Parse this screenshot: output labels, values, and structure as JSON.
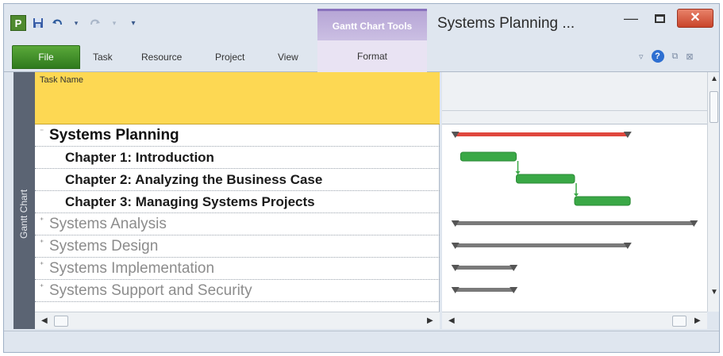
{
  "titlebar": {
    "app_icon_letter": "P",
    "undo_icon": "undo-icon",
    "redo_icon": "redo-icon",
    "contextual_tab_group": "Gantt Chart Tools",
    "document_title": "Systems Planning ...",
    "minimize_glyph": "—",
    "close_glyph": "✕"
  },
  "ribbon": {
    "file_tab": "File",
    "tabs": [
      "Task",
      "Resource",
      "Project",
      "View"
    ],
    "format_tab": "Format",
    "help_glyph": "?"
  },
  "side_label": "Gantt Chart",
  "grid": {
    "column_header": "Task Name",
    "rows": [
      {
        "name": "Systems Planning",
        "level": 1,
        "expanded": true
      },
      {
        "name": "Chapter 1: Introduction",
        "level": 2
      },
      {
        "name": "Chapter 2: Analyzing the Business Case",
        "level": 2
      },
      {
        "name": "Chapter 3: Managing Systems Projects",
        "level": 2
      },
      {
        "name": "Systems Analysis",
        "level": 1,
        "expanded": false
      },
      {
        "name": "Systems Design",
        "level": 1,
        "expanded": false
      },
      {
        "name": "Systems Implementation",
        "level": 1,
        "expanded": false
      },
      {
        "name": "Systems Support and Security",
        "level": 1,
        "expanded": false
      }
    ]
  },
  "gantt": {
    "colors": {
      "critical_summary": "#e0473d",
      "task_bar": "#3aa846",
      "summary": "#7a7a7a",
      "link": "#3aa846"
    },
    "bars": [
      {
        "type": "summary",
        "color": "critical",
        "start": 0.05,
        "end": 0.7
      },
      {
        "type": "task",
        "start": 0.07,
        "end": 0.28
      },
      {
        "type": "task",
        "start": 0.28,
        "end": 0.5
      },
      {
        "type": "task",
        "start": 0.5,
        "end": 0.71
      },
      {
        "type": "summary",
        "color": "summary",
        "start": 0.05,
        "end": 0.95
      },
      {
        "type": "summary",
        "color": "summary",
        "start": 0.05,
        "end": 0.7
      },
      {
        "type": "summary",
        "color": "summary",
        "start": 0.05,
        "end": 0.27
      },
      {
        "type": "summary",
        "color": "summary",
        "start": 0.05,
        "end": 0.27
      }
    ]
  }
}
